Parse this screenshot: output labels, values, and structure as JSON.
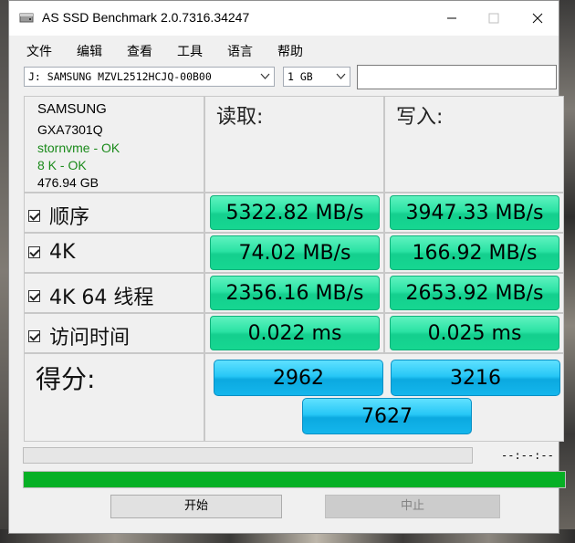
{
  "window": {
    "title": "AS SSD Benchmark 2.0.7316.34247"
  },
  "menu": [
    "文件",
    "编辑",
    "查看",
    "工具",
    "语言",
    "帮助"
  ],
  "drive_select": {
    "value": "J: SAMSUNG MZVL2512HCJQ-00B00"
  },
  "size_select": {
    "value": "1 GB"
  },
  "drive_info": {
    "vendor": "SAMSUNG",
    "firmware": "GXA7301Q",
    "driver": "stornvme - OK",
    "alignment": "8 K - OK",
    "capacity": "476.94 GB"
  },
  "columns": {
    "read": "读取:",
    "write": "写入:"
  },
  "rows": [
    {
      "label": "顺序",
      "read": "5322.82 MB/s",
      "write": "3947.33 MB/s",
      "checked": true
    },
    {
      "label": "4K",
      "read": "74.02 MB/s",
      "write": "166.92 MB/s",
      "checked": true
    },
    {
      "label": "4K 64 线程",
      "read": "2356.16 MB/s",
      "write": "2653.92 MB/s",
      "checked": true
    },
    {
      "label": "访问时间",
      "read": "0.022 ms",
      "write": "0.025 ms",
      "checked": true
    }
  ],
  "score": {
    "label": "得分:",
    "read": "2962",
    "write": "3216",
    "total": "7627"
  },
  "progress": {
    "time": "--:--:--",
    "completed": 1.0
  },
  "buttons": {
    "start": "开始",
    "stop": "中止"
  },
  "colors": {
    "progress_green": "#06b025",
    "result_green": "#2be3a4",
    "score_blue": "#27c7f6"
  }
}
